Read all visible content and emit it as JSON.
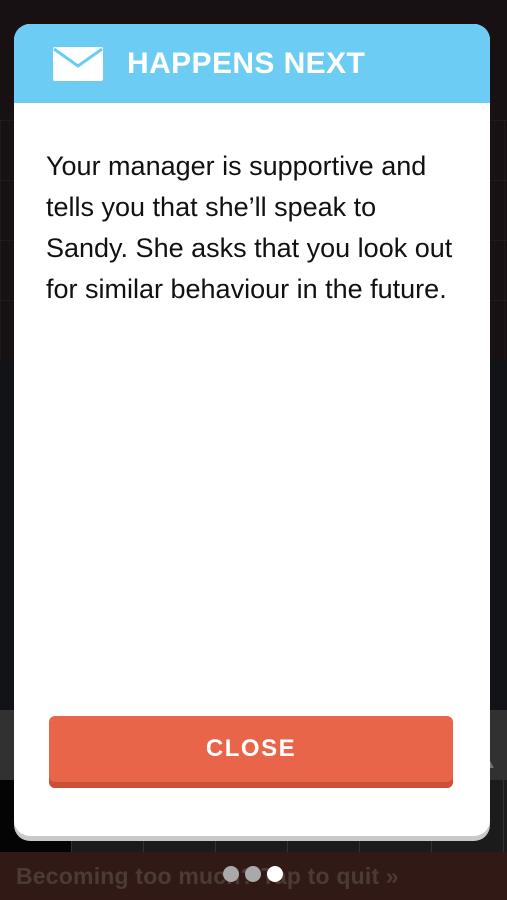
{
  "background": {
    "quit_banner": "Becoming too much? Tap to quit »"
  },
  "modal": {
    "header_title": "HAPPENS NEXT",
    "header_icon": "envelope-icon",
    "body_text": "Your manager is supportive and tells you that she’ll speak to Sandy. She asks that you look out for similar behaviour in the future.",
    "close_label": "CLOSE"
  },
  "pagination": {
    "total": 3,
    "active_index": 2
  },
  "colors": {
    "header": "#6dccf3",
    "close_button": "#e8654a"
  }
}
